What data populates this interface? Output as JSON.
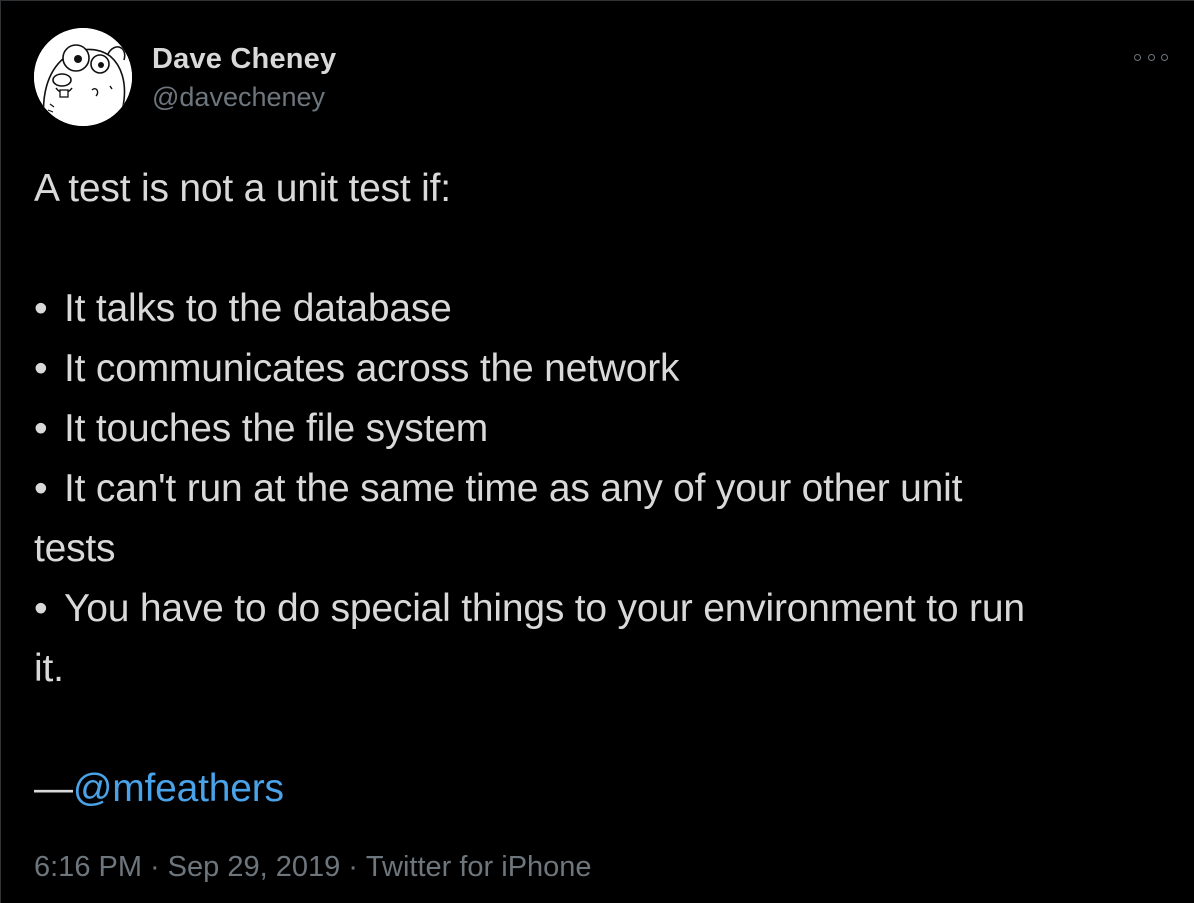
{
  "author": {
    "display_name": "Dave Cheney",
    "handle": "@davecheney"
  },
  "more_button": {
    "icon": "more-horizontal-icon"
  },
  "tweet": {
    "intro": "A test is not a unit test if:",
    "bullet_glyph": "•",
    "bullets": [
      "It talks to the database",
      "It communicates across the network",
      "It touches the file system",
      "It can't run at the same time as any of your other unit",
      "You have to do special things to your environment to run"
    ],
    "bullet_4_continuation": "tests",
    "bullet_5_continuation": "it.",
    "attribution_prefix": "—",
    "attribution_mention": "@mfeathers"
  },
  "meta": {
    "time": "6:16 PM",
    "separator": "·",
    "date": "Sep 29, 2019",
    "source": "Twitter for iPhone"
  },
  "colors": {
    "background": "#000000",
    "text": "#d9d9d9",
    "secondary": "#6e767d",
    "link": "#4aa3e8"
  }
}
